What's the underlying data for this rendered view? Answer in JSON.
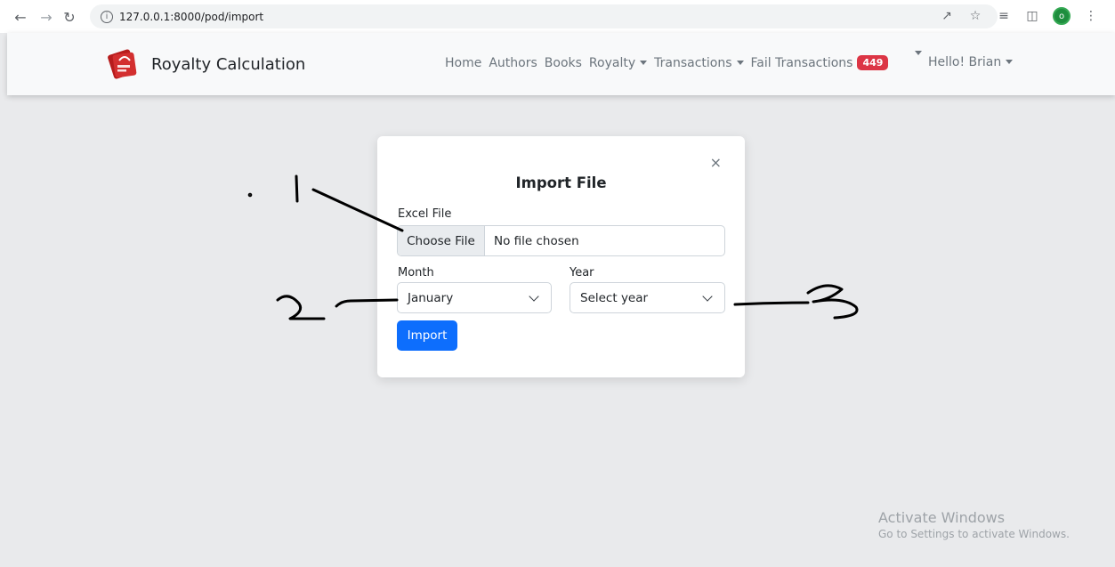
{
  "browser": {
    "url": "127.0.0.1:8000/pod/import",
    "profile_initial": "o"
  },
  "navbar": {
    "brand": "Royalty Calculation",
    "links": {
      "home": "Home",
      "authors": "Authors",
      "books": "Books",
      "royalty": "Royalty",
      "transactions": "Transactions",
      "fail_transactions": "Fail Transactions",
      "fail_count": "449"
    },
    "user": "Hello! Brian"
  },
  "modal": {
    "title": "Import File",
    "close": "×",
    "excel_label": "Excel File",
    "choose_file": "Choose File",
    "no_file": "No file chosen",
    "month_label": "Month",
    "month_value": "January",
    "year_label": "Year",
    "year_placeholder": "Select year",
    "import_button": "Import"
  },
  "annotations": {
    "one": "1",
    "two": "2",
    "three": "3"
  },
  "watermark": {
    "title": "Activate Windows",
    "subtitle": "Go to Settings to activate Windows."
  },
  "colors": {
    "primary": "#0d6efd",
    "badge": "#dc3545",
    "backdrop": "#e9eaec"
  }
}
